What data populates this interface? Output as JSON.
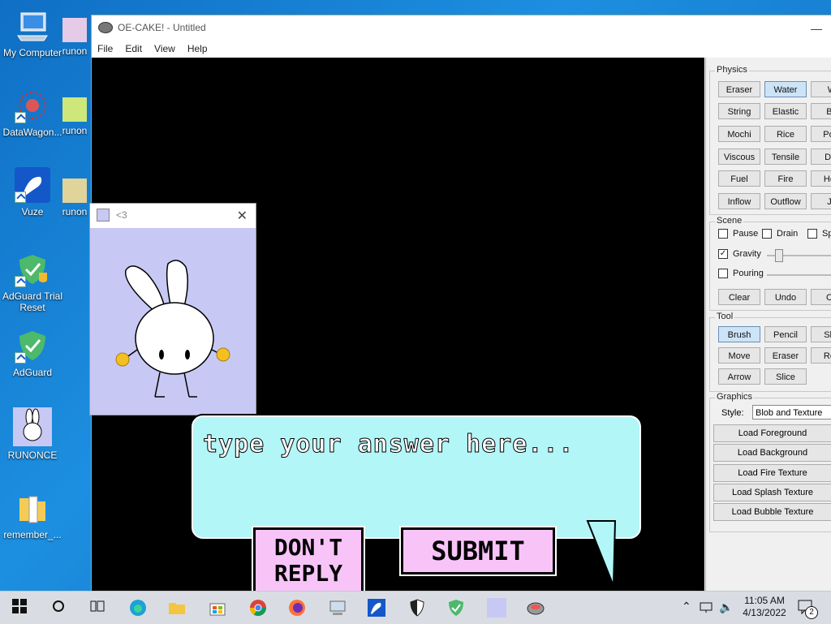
{
  "desktop": {
    "icons": [
      {
        "label": "My Computer"
      },
      {
        "label": "runon"
      },
      {
        "label": "DataWagon..."
      },
      {
        "label": "runon"
      },
      {
        "label": "Vuze"
      },
      {
        "label": "runon"
      },
      {
        "label": "AdGuard Trial Reset"
      },
      {
        "label": "AdGuard"
      },
      {
        "label": "RUNONCE"
      },
      {
        "label": "remember_..."
      }
    ]
  },
  "window": {
    "title": "OE-CAKE! - Untitled",
    "menu": [
      "File",
      "Edit",
      "View",
      "Help"
    ]
  },
  "panel": {
    "physics": {
      "legend": "Physics",
      "buttons": [
        "Eraser",
        "Water",
        "W",
        "String",
        "Elastic",
        "Bri",
        "Mochi",
        "Rice",
        "Pow",
        "Viscous",
        "Tensile",
        "Der",
        "Fuel",
        "Fire",
        "Hea",
        "Inflow",
        "Outflow",
        "Je"
      ]
    },
    "scene": {
      "legend": "Scene",
      "pause": "Pause",
      "drain": "Drain",
      "sp": "Sp",
      "gravity": "Gravity",
      "pouring": "Pouring",
      "clear": "Clear",
      "undo": "Undo",
      "co": "Co"
    },
    "tool": {
      "legend": "Tool",
      "buttons": [
        "Brush",
        "Pencil",
        "Sha",
        "Move",
        "Eraser",
        "Rep",
        "Arrow",
        "Slice"
      ]
    },
    "graphics": {
      "legend": "Graphics",
      "style_label": "Style:",
      "style_value": "Blob and Texture",
      "buttons": [
        "Load Foreground",
        "Load Background",
        "Load Fire Texture",
        "Load Splash Texture",
        "Load Bubble Texture"
      ]
    }
  },
  "popup": {
    "title": "<3"
  },
  "dialog": {
    "placeholder": "type your answer here...",
    "dont_reply": "DON'T REPLY",
    "submit": "SUBMIT"
  },
  "taskbar": {
    "time": "11:05 AM",
    "date": "4/13/2022",
    "notifications": "2"
  },
  "colors": {
    "bubble": "#b2f6f8",
    "button_pink": "#f8c4f8",
    "popup_bg": "#c8c8f4",
    "canvas": "#000000"
  }
}
